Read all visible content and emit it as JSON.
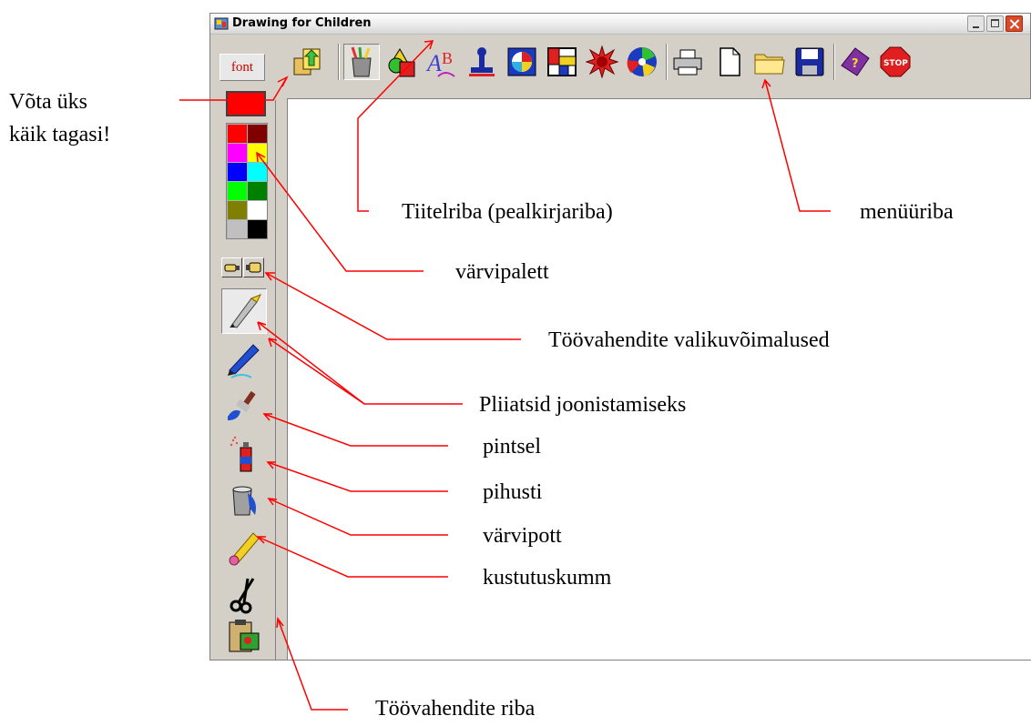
{
  "window": {
    "title": "Drawing for Children"
  },
  "toolbar": {
    "font_label": "font",
    "tools": [
      {
        "name": "undo-icon"
      },
      {
        "name": "drawing-tools-icon"
      },
      {
        "name": "shapes-icon"
      },
      {
        "name": "text-icon"
      },
      {
        "name": "stamp-icon"
      },
      {
        "name": "picture-icon"
      },
      {
        "name": "mosaic-icon"
      },
      {
        "name": "burst-icon"
      },
      {
        "name": "swirl-icon"
      },
      {
        "name": "printer-icon"
      },
      {
        "name": "new-file-icon"
      },
      {
        "name": "open-folder-icon"
      },
      {
        "name": "save-icon"
      },
      {
        "name": "help-book-icon"
      },
      {
        "name": "stop-icon"
      }
    ]
  },
  "palette": {
    "current": "#ff0000",
    "colors": [
      "#ff0000",
      "#800000",
      "#ff00ff",
      "#ffff00",
      "#0000ff",
      "#00ffff",
      "#00ff00",
      "#008000",
      "#808000",
      "#ffffff",
      "#c0c0c0",
      "#000000"
    ]
  },
  "sidebar_tools": [
    {
      "name": "pencil-icon"
    },
    {
      "name": "pen-icon"
    },
    {
      "name": "brush-icon"
    },
    {
      "name": "spray-icon"
    },
    {
      "name": "paint-bucket-icon"
    },
    {
      "name": "eraser-icon"
    },
    {
      "name": "scissors-icon"
    },
    {
      "name": "clipboard-icon"
    }
  ],
  "annotations": {
    "undo": "Võta üks\nkäik tagasi!",
    "titlebar": "Tiitelriba (pealkirjariba)",
    "menubar": "menüüriba",
    "palette": "värvipalett",
    "options": "Töövahendite valikuvõimalused",
    "pencils": "Pliiatsid joonistamiseks",
    "brush": "pintsel",
    "spray": "pihusti",
    "bucket": "värvipott",
    "eraser": "kustutuskumm",
    "toolbar": "Töövahendite riba"
  }
}
